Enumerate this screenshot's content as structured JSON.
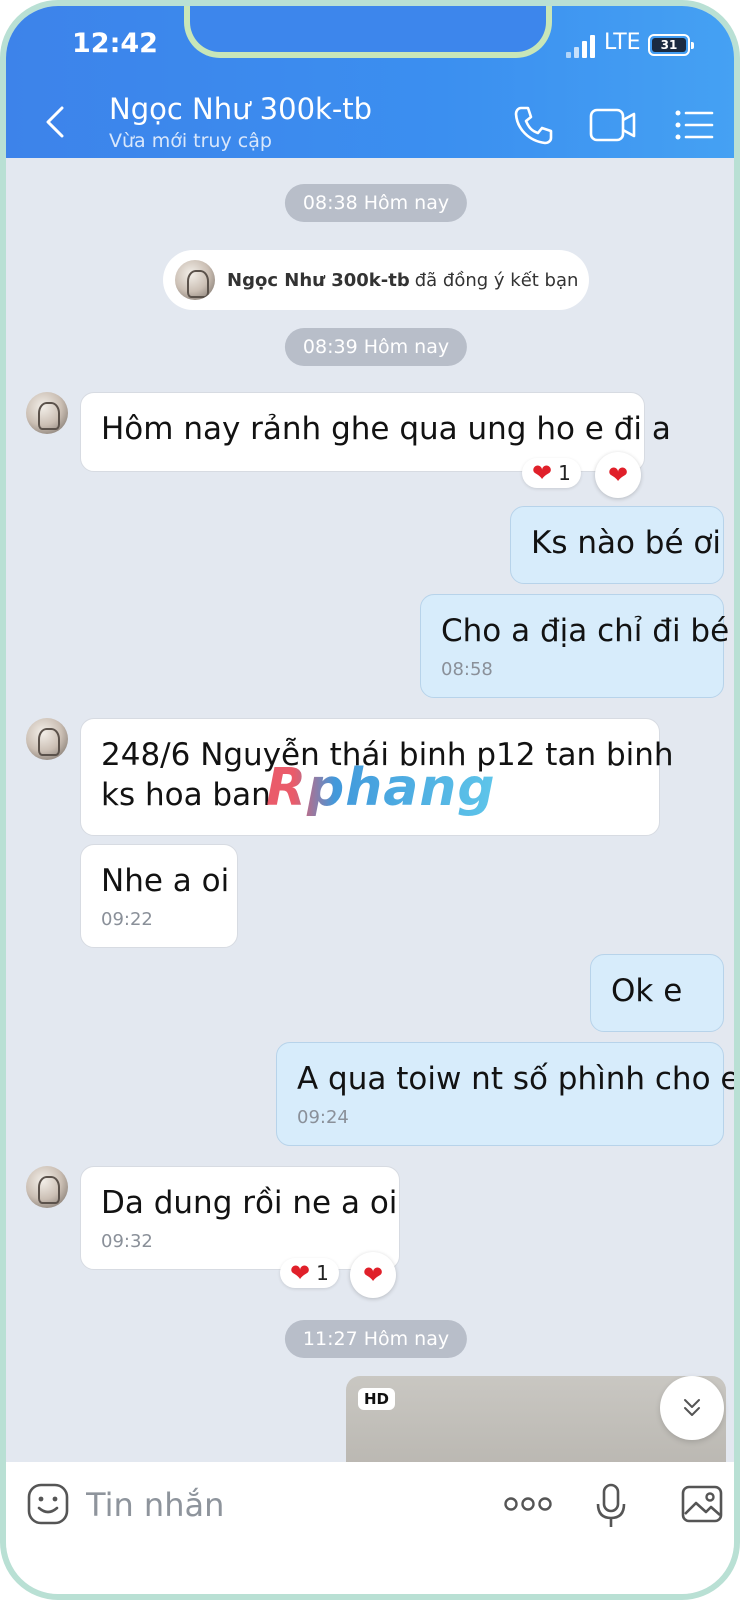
{
  "status_bar": {
    "time": "12:42",
    "network": "LTE",
    "battery": "31"
  },
  "header": {
    "contact_name": "Ngọc Như 300k-tb",
    "contact_status": "Vừa mới truy cập",
    "icons": [
      "back-icon",
      "phone-icon",
      "video-call-icon",
      "menu-list-icon"
    ]
  },
  "chat": {
    "timestamps": [
      "08:38 Hôm nay",
      "08:39 Hôm nay",
      "11:27 Hôm nay"
    ],
    "system_note": {
      "name": "Ngọc Như 300k-tb",
      "text": "đã đồng ý kết bạn"
    },
    "messages": [
      {
        "dir": "in",
        "text": "Hôm nay rảnh ghe qua ung ho e đi a",
        "reaction_count": "1"
      },
      {
        "dir": "out",
        "text": "Ks nào bé ơi"
      },
      {
        "dir": "out",
        "text": "Cho a địa chỉ đi bé",
        "time": "08:58"
      },
      {
        "dir": "in",
        "text_line1": "248/6 Nguyễn thái binh p12 tan binh",
        "text_line2": "ks hoa ban"
      },
      {
        "dir": "in",
        "text": "Nhe a oi",
        "time": "09:22"
      },
      {
        "dir": "out",
        "text": "Ok e"
      },
      {
        "dir": "out",
        "text": "A qua toiw nt số phình cho e",
        "time": "09:24"
      },
      {
        "dir": "in",
        "text": "Da dung rồi ne a oi",
        "time": "09:32",
        "reaction_count": "1"
      }
    ],
    "media_badge": "HD",
    "watermark": "Rphang"
  },
  "input_bar": {
    "placeholder": "Tin nhắn"
  },
  "colors": {
    "header": "#3d83ea",
    "chat_bg": "#e3e8f0",
    "out_bubble": "#d7ecfb",
    "in_bubble": "#ffffff",
    "heart": "#e0202a"
  }
}
